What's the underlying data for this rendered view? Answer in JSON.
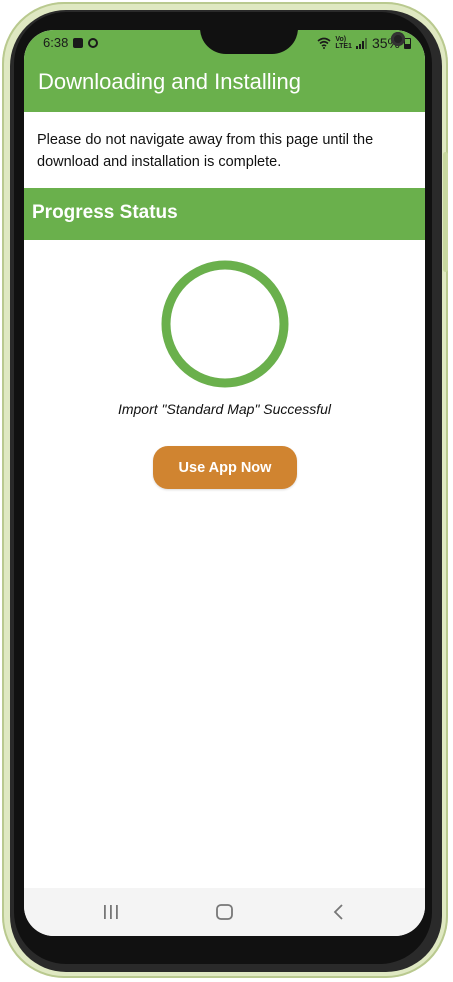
{
  "status_bar": {
    "time": "6:38",
    "network_label_top": "Vo)",
    "network_label_bottom": "LTE1",
    "battery_percent": "35%"
  },
  "header": {
    "title": "Downloading and Installing"
  },
  "notice": {
    "text": "Please do not navigate away from this page until the download and installation is complete."
  },
  "progress": {
    "section_title": "Progress Status",
    "status_message": "Import \"Standard Map\" Successful",
    "ring_color": "#6ab04c",
    "complete_fraction": 1.0
  },
  "actions": {
    "use_app_label": "Use App Now",
    "button_color": "#d08430"
  },
  "theme": {
    "primary": "#6ab04c"
  }
}
